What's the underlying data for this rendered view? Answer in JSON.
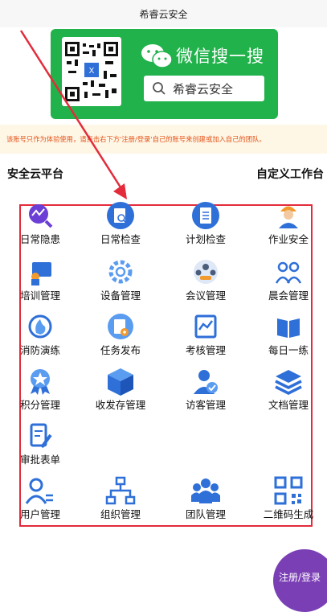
{
  "header": {
    "title": "希睿云安全"
  },
  "banner": {
    "wechat_text": "微信搜一搜",
    "search_query": "希睿云安全"
  },
  "notice": {
    "text": "该账号只作为体验使用，请点击右下方'注册/登录'自己的账号来创建或加入自己的团队。"
  },
  "sections": {
    "left": "安全云平台",
    "right": "自定义工作台"
  },
  "grid": {
    "items": [
      {
        "label": "日常隐患",
        "icon": "chart-search-icon"
      },
      {
        "label": "日常检查",
        "icon": "document-search-icon"
      },
      {
        "label": "计划检查",
        "icon": "clipboard-icon"
      },
      {
        "label": "作业安全",
        "icon": "worker-icon"
      },
      {
        "label": "培训管理",
        "icon": "training-icon"
      },
      {
        "label": "设备管理",
        "icon": "gear-icon"
      },
      {
        "label": "会议管理",
        "icon": "meeting-icon"
      },
      {
        "label": "晨会管理",
        "icon": "group-icon"
      },
      {
        "label": "消防演练",
        "icon": "fire-drill-icon"
      },
      {
        "label": "任务发布",
        "icon": "task-icon"
      },
      {
        "label": "考核管理",
        "icon": "assessment-icon"
      },
      {
        "label": "每日一练",
        "icon": "book-icon"
      },
      {
        "label": "积分管理",
        "icon": "medal-icon"
      },
      {
        "label": "收发存管理",
        "icon": "box-icon"
      },
      {
        "label": "访客管理",
        "icon": "visitor-icon"
      },
      {
        "label": "文档管理",
        "icon": "layers-icon"
      },
      {
        "label": "审批表单",
        "icon": "form-edit-icon"
      },
      {
        "label": "用户管理",
        "icon": "user-list-icon"
      },
      {
        "label": "组织管理",
        "icon": "org-chart-icon"
      },
      {
        "label": "团队管理",
        "icon": "team-icon"
      },
      {
        "label": "二维码生成",
        "icon": "qrcode-icon"
      }
    ]
  },
  "fab": {
    "label": "注册/登录"
  },
  "colors": {
    "banner_green": "#21b24b",
    "accent_blue": "#2e6fd8",
    "annotation_red": "#e32b3b",
    "fab_purple": "#7b3fb5"
  }
}
